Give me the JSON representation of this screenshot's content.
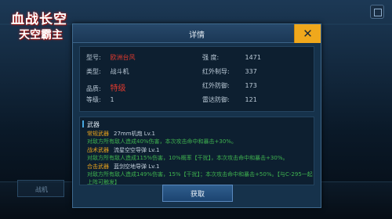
{
  "logo": {
    "line1": "血战长空",
    "line2": "天空霸主"
  },
  "background": {
    "card_label": "战机"
  },
  "dialog": {
    "title": "详情",
    "close_label": "✕",
    "stats_left": [
      {
        "label": "型号:",
        "value": "欧洲台风",
        "color": "#e23a2e"
      },
      {
        "label": "类型:",
        "value": "战斗机",
        "color": "#bccbd8"
      },
      {
        "label": "品质:",
        "value": "特级",
        "color": "#e23a2e"
      },
      {
        "label": "等级:",
        "value": "1",
        "color": "#bccbd8"
      }
    ],
    "stats_right": [
      {
        "label": "强    度:",
        "value": "1471"
      },
      {
        "label": "红外制导:",
        "value": "337"
      },
      {
        "label": "红外防御:",
        "value": "173"
      },
      {
        "label": "雷达防御:",
        "value": "121"
      }
    ],
    "weapons_heading": "武器",
    "weapons": [
      {
        "type": "常规武器",
        "item": "27mm机炮  Lv.1",
        "desc": "对敌方所有敌人造成40%伤害，本次攻击命中和暴击+30%。"
      },
      {
        "type": "战术武器",
        "item": "流星空空导弹  Lv.1",
        "desc": "对敌方所有敌人造成115%伤害，10%概率【干扰】，本次攻击命中和暴击+30%。"
      },
      {
        "type": "合击武器",
        "item": "蓝剑空地导弹  Lv.1",
        "desc": "对敌方所有敌人造成149%伤害，15%【干扰】；本次攻击命中和暴击+50%。【与C-295一起上阵可触发】"
      }
    ],
    "obtain_label": "获取"
  }
}
